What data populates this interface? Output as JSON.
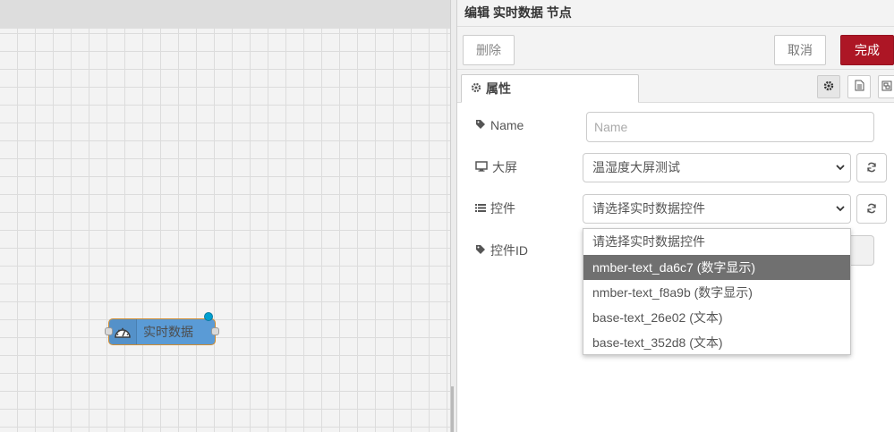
{
  "workspace": {
    "node": {
      "label": "实时数据",
      "icon": "gauge-icon"
    }
  },
  "tray": {
    "title": "编辑 实时数据 节点",
    "buttons": {
      "delete": "删除",
      "cancel": "取消",
      "done": "完成"
    },
    "tabs": {
      "properties": "属性"
    },
    "form": {
      "name": {
        "label": "Name",
        "placeholder": "Name",
        "value": ""
      },
      "screen": {
        "label": "大屏",
        "value": "温湿度大屏测试"
      },
      "control": {
        "label": "控件",
        "value": "请选择实时数据控件"
      },
      "control_id": {
        "label": "控件ID"
      }
    },
    "dropdown": {
      "options": [
        "请选择实时数据控件",
        "nmber-text_da6c7 (数字显示)",
        "nmber-text_f8a9b (数字显示)",
        "base-text_26e02 (文本)",
        "base-text_352d8 (文本)"
      ],
      "highlighted_index": 1
    }
  },
  "colors": {
    "done_button": "#ad1625",
    "node_fill": "#5a9bd6",
    "node_border": "#d08b2f",
    "highlight": "#707070"
  }
}
